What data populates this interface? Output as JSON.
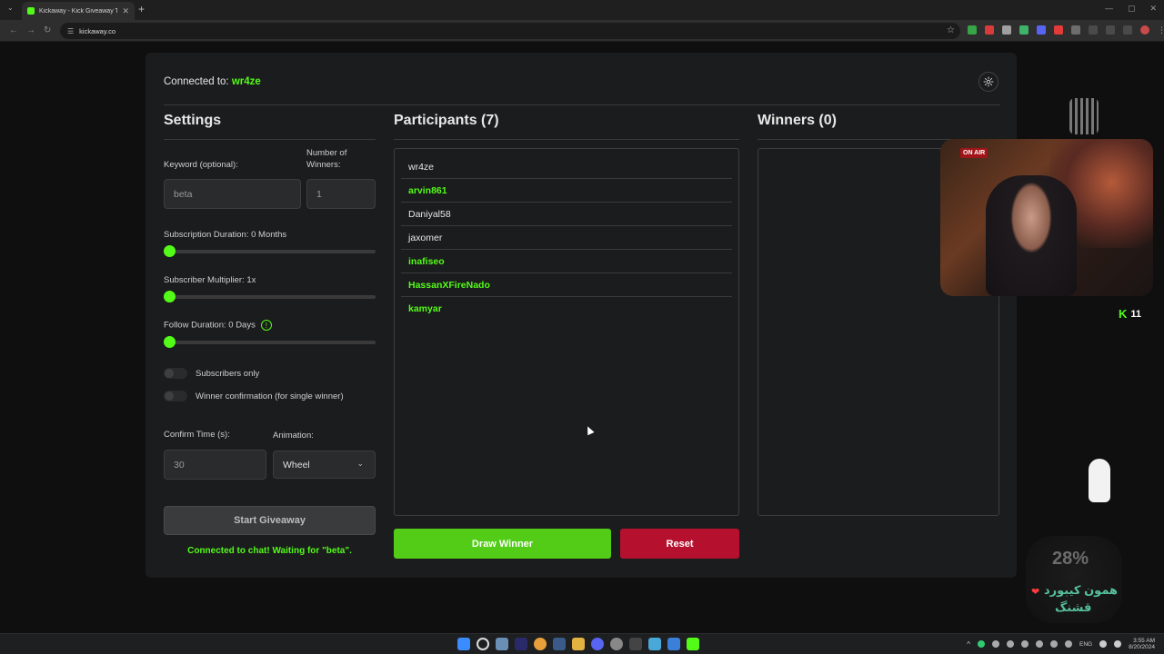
{
  "browser": {
    "tab_title": "Kickaway - Kick Giveaway Tool",
    "url": "kickaway.co"
  },
  "header": {
    "connected_label": "Connected to:",
    "connected_user": "wr4ze"
  },
  "settings": {
    "title": "Settings",
    "keyword_label": "Keyword (optional):",
    "keyword_value": "beta",
    "winners_label": "Number of Winners:",
    "winners_value": "1",
    "sub_duration_label": "Subscription Duration: 0 Months",
    "sub_multiplier_label": "Subscriber Multiplier: 1x",
    "follow_duration_label": "Follow Duration:  0  Days",
    "subscribers_only_label": "Subscribers only",
    "winner_confirm_label": "Winner confirmation (for single winner)",
    "confirm_time_label": "Confirm Time (s):",
    "confirm_time_value": "30",
    "animation_label": "Animation:",
    "animation_value": "Wheel",
    "start_button": "Start Giveaway",
    "status_text": "Connected to chat! Waiting for \"beta\"."
  },
  "participants": {
    "title": "Participants (7)",
    "list": [
      {
        "name": "wr4ze",
        "subscriber": false
      },
      {
        "name": "arvin861",
        "subscriber": true
      },
      {
        "name": "Daniyal58",
        "subscriber": false
      },
      {
        "name": "jaxomer",
        "subscriber": false
      },
      {
        "name": "inafiseo",
        "subscriber": true
      },
      {
        "name": "HassanXFireNado",
        "subscriber": true
      },
      {
        "name": "kamyar",
        "subscriber": true
      }
    ],
    "draw_button": "Draw Winner",
    "reset_button": "Reset"
  },
  "winners": {
    "title": "Winners (0)"
  },
  "overlay": {
    "onair": "ON AIR",
    "kick_count": "11",
    "percent": "28%",
    "fa_line1": "همون کیبورد",
    "fa_line2": "قشنگ"
  },
  "taskbar": {
    "time": "3:55 AM",
    "date": "8/20/2024",
    "lang": "ENG"
  },
  "colors": {
    "accent": "#53fc18",
    "reset": "#b5112f",
    "draw": "#53cc17"
  }
}
